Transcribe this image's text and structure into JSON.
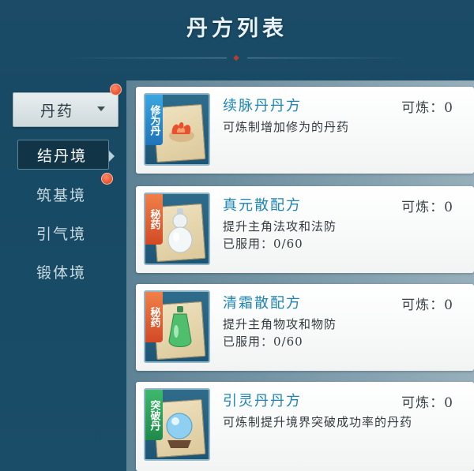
{
  "header": {
    "title": "丹方列表"
  },
  "sidebar": {
    "dropdown": {
      "label": "丹药"
    },
    "items": [
      {
        "label": "结丹境",
        "active": true
      },
      {
        "label": "筑基境",
        "active": false
      },
      {
        "label": "引气境",
        "active": false
      },
      {
        "label": "锻体境",
        "active": false
      }
    ]
  },
  "recipes": [
    {
      "tag": "修为丹",
      "tag_color": "blue",
      "name": "续脉丹丹方",
      "craftable": "可炼：0",
      "description": "可炼制增加修为的丹药",
      "used": "",
      "icon": "flame-pill-icon"
    },
    {
      "tag": "秘药",
      "tag_color": "red",
      "name": "真元散配方",
      "craftable": "可炼：0",
      "description": "提升主角法攻和法防",
      "used": "已服用：0/60",
      "icon": "white-gourd-icon"
    },
    {
      "tag": "秘药",
      "tag_color": "red",
      "name": "清霜散配方",
      "craftable": "可炼：0",
      "description": "提升主角物攻和物防",
      "used": "已服用：0/60",
      "icon": "green-gourd-icon"
    },
    {
      "tag": "突破丹",
      "tag_color": "green",
      "name": "引灵丹丹方",
      "craftable": "可炼：0",
      "description": "可炼制提升境界突破成功率的丹药",
      "used": "",
      "icon": "crystal-orb-icon"
    }
  ],
  "colors": {
    "background": "#1b4b66",
    "accent_text": "#1d84b5",
    "badge": "#e8502e"
  }
}
